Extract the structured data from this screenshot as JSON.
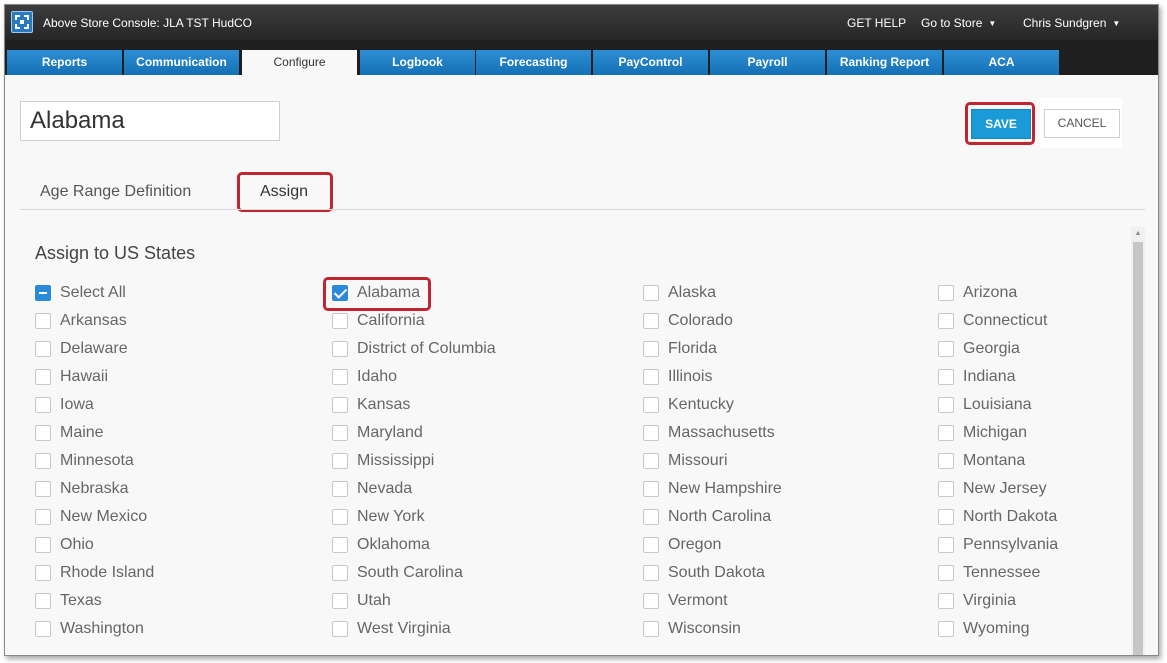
{
  "app": {
    "title": "Above Store Console: JLA TST HudCO",
    "get_help": "GET HELP",
    "go_to_store": "Go to Store",
    "user": "Chris Sundgren"
  },
  "nav_tabs": [
    {
      "label": "Reports"
    },
    {
      "label": "Communication"
    },
    {
      "label": "Configure",
      "active": true
    },
    {
      "label": "Logbook"
    },
    {
      "label": "Forecasting"
    },
    {
      "label": "PayControl"
    },
    {
      "label": "Payroll"
    },
    {
      "label": "Ranking Report"
    },
    {
      "label": "ACA"
    }
  ],
  "form": {
    "name_value": "Alabama",
    "save_label": "SAVE",
    "cancel_label": "CANCEL"
  },
  "sub_tabs": {
    "age_range": "Age Range Definition",
    "assign": "Assign"
  },
  "section": {
    "title": "Assign to US States",
    "select_all": {
      "label": "Select All",
      "state": "partial"
    },
    "states": [
      {
        "label": "Alabama",
        "checked": true
      },
      {
        "label": "Alaska",
        "checked": false
      },
      {
        "label": "Arizona",
        "checked": false
      },
      {
        "label": "Arkansas",
        "checked": false
      },
      {
        "label": "California",
        "checked": false
      },
      {
        "label": "Colorado",
        "checked": false
      },
      {
        "label": "Connecticut",
        "checked": false
      },
      {
        "label": "Delaware",
        "checked": false
      },
      {
        "label": "District of Columbia",
        "checked": false
      },
      {
        "label": "Florida",
        "checked": false
      },
      {
        "label": "Georgia",
        "checked": false
      },
      {
        "label": "Hawaii",
        "checked": false
      },
      {
        "label": "Idaho",
        "checked": false
      },
      {
        "label": "Illinois",
        "checked": false
      },
      {
        "label": "Indiana",
        "checked": false
      },
      {
        "label": "Iowa",
        "checked": false
      },
      {
        "label": "Kansas",
        "checked": false
      },
      {
        "label": "Kentucky",
        "checked": false
      },
      {
        "label": "Louisiana",
        "checked": false
      },
      {
        "label": "Maine",
        "checked": false
      },
      {
        "label": "Maryland",
        "checked": false
      },
      {
        "label": "Massachusetts",
        "checked": false
      },
      {
        "label": "Michigan",
        "checked": false
      },
      {
        "label": "Minnesota",
        "checked": false
      },
      {
        "label": "Mississippi",
        "checked": false
      },
      {
        "label": "Missouri",
        "checked": false
      },
      {
        "label": "Montana",
        "checked": false
      },
      {
        "label": "Nebraska",
        "checked": false
      },
      {
        "label": "Nevada",
        "checked": false
      },
      {
        "label": "New Hampshire",
        "checked": false
      },
      {
        "label": "New Jersey",
        "checked": false
      },
      {
        "label": "New Mexico",
        "checked": false
      },
      {
        "label": "New York",
        "checked": false
      },
      {
        "label": "North Carolina",
        "checked": false
      },
      {
        "label": "North Dakota",
        "checked": false
      },
      {
        "label": "Ohio",
        "checked": false
      },
      {
        "label": "Oklahoma",
        "checked": false
      },
      {
        "label": "Oregon",
        "checked": false
      },
      {
        "label": "Pennsylvania",
        "checked": false
      },
      {
        "label": "Rhode Island",
        "checked": false
      },
      {
        "label": "South Carolina",
        "checked": false
      },
      {
        "label": "South Dakota",
        "checked": false
      },
      {
        "label": "Tennessee",
        "checked": false
      },
      {
        "label": "Texas",
        "checked": false
      },
      {
        "label": "Utah",
        "checked": false
      },
      {
        "label": "Vermont",
        "checked": false
      },
      {
        "label": "Virginia",
        "checked": false
      },
      {
        "label": "Washington",
        "checked": false
      },
      {
        "label": "West Virginia",
        "checked": false
      },
      {
        "label": "Wisconsin",
        "checked": false
      },
      {
        "label": "Wyoming",
        "checked": false
      }
    ]
  },
  "colors": {
    "accent": "#1a9ad6",
    "nav_tab": "#1f7fc4",
    "highlight": "#c0262f",
    "checked": "#2a8ad8"
  }
}
